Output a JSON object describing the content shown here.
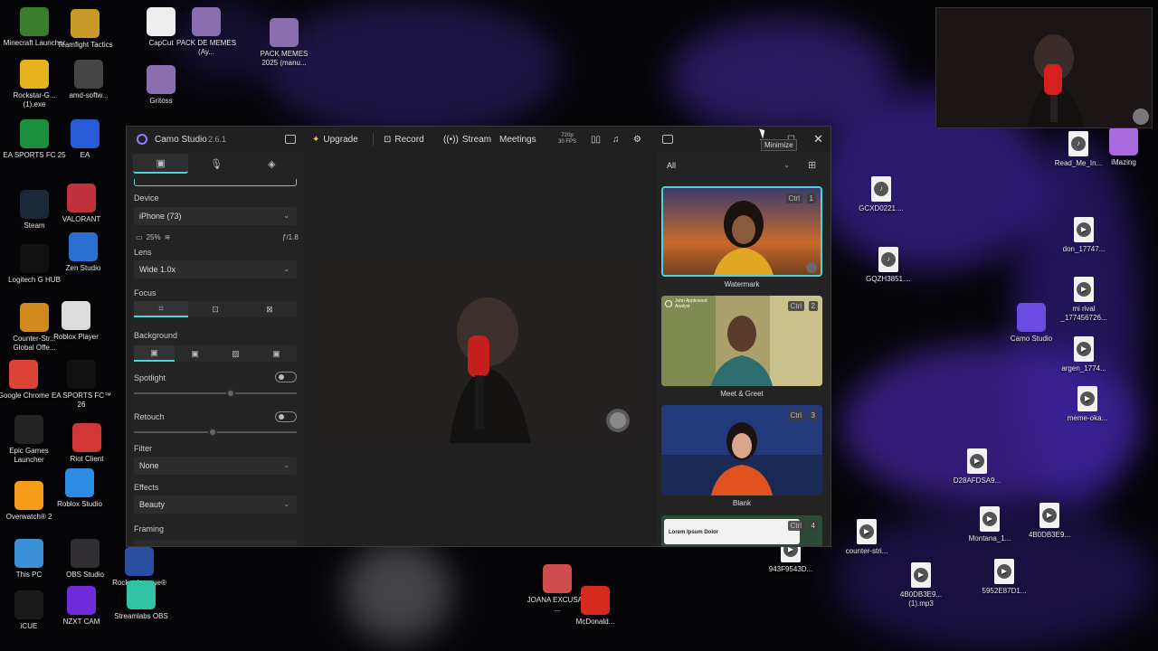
{
  "desktop_icons": [
    {
      "label": "Minecraft Launcher",
      "icon": "minecraft-icon",
      "color": "#3a7d2a"
    },
    {
      "label": "Teamfight Tactics",
      "icon": "tft-icon",
      "color": "#c79a2a"
    },
    {
      "label": "CapCut",
      "icon": "capcut-icon",
      "color": "#eeeeee"
    },
    {
      "label": "PACK DE MEMES (Ay...",
      "icon": "archive-icon",
      "color": "#8a6fb0"
    },
    {
      "label": "PACK MEMES 2025 (manu...",
      "icon": "archive-icon",
      "color": "#8a6fb0"
    },
    {
      "label": "Rockstar-G... (1).exe",
      "icon": "rockstar-icon",
      "color": "#e6b31e"
    },
    {
      "label": "amd-softw...",
      "icon": "amd-icon",
      "color": "#444444"
    },
    {
      "label": "Gritoss",
      "icon": "archive-icon",
      "color": "#8a6fb0"
    },
    {
      "label": "EA SPORTS FC 25",
      "icon": "fc25-icon",
      "color": "#1c8f3e"
    },
    {
      "label": "EA",
      "icon": "ea-icon",
      "color": "#2a5bd7"
    },
    {
      "label": "Steam",
      "icon": "steam-icon",
      "color": "#1b2838"
    },
    {
      "label": "VALORANT",
      "icon": "valorant-icon",
      "color": "#c0313f"
    },
    {
      "label": "Logitech G HUB",
      "icon": "ghub-icon",
      "color": "#111111"
    },
    {
      "label": "Zen Studio",
      "icon": "zen-icon",
      "color": "#2a6fd0"
    },
    {
      "label": "Counter-Str... Global Offe...",
      "icon": "csgo-icon",
      "color": "#d08a1e"
    },
    {
      "label": "Roblox Player",
      "icon": "roblox-icon",
      "color": "#dddddd"
    },
    {
      "label": "Google Chrome",
      "icon": "chrome-icon",
      "color": "#db4437"
    },
    {
      "label": "EA SPORTS FC™ 26",
      "icon": "fc26-icon",
      "color": "#111111"
    },
    {
      "label": "Epic Games Launcher",
      "icon": "epic-icon",
      "color": "#222222"
    },
    {
      "label": "Riot Client",
      "icon": "riot-icon",
      "color": "#d13639"
    },
    {
      "label": "Overwatch® 2",
      "icon": "overwatch-icon",
      "color": "#f99e1a"
    },
    {
      "label": "Roblox Studio",
      "icon": "roblox-studio-icon",
      "color": "#2d8ae3"
    },
    {
      "label": "This PC",
      "icon": "pc-icon",
      "color": "#3b8fd6"
    },
    {
      "label": "OBS Studio",
      "icon": "obs-icon",
      "color": "#302e31"
    },
    {
      "label": "Rocket League®",
      "icon": "rocket-league-icon",
      "color": "#2b4ea2"
    },
    {
      "label": "Streamlabs OBS",
      "icon": "streamlabs-icon",
      "color": "#31c3a2"
    },
    {
      "label": "iCUE",
      "icon": "icue-icon",
      "color": "#1a1a1a"
    },
    {
      "label": "NZXT CAM",
      "icon": "nzxt-icon",
      "color": "#6e2bd9"
    },
    {
      "label": "JOANA EXCUSAS ...",
      "icon": "archive-icon",
      "color": "#d04b4b"
    },
    {
      "label": "McDonald...",
      "icon": "mcdonalds-icon",
      "color": "#d52b1e"
    },
    {
      "label": "Read_Me_In...",
      "icon": "text-file-icon",
      "color": "#eeeeee"
    },
    {
      "label": "iMazing",
      "icon": "imazing-icon",
      "color": "#a86be0"
    },
    {
      "label": "GCXD0221....",
      "icon": "audio-file-icon",
      "color": "#eeeeee"
    },
    {
      "label": "don_17747...",
      "icon": "video-file-icon",
      "color": "#eeeeee"
    },
    {
      "label": "GQZH3851....",
      "icon": "audio-file-icon",
      "color": "#eeeeee"
    },
    {
      "label": "mi rival _177456726...",
      "icon": "video-file-icon",
      "color": "#eeeeee"
    },
    {
      "label": "Camo Studio",
      "icon": "camo-icon",
      "color": "#6a4de0"
    },
    {
      "label": "argen_1774...",
      "icon": "video-file-icon",
      "color": "#eeeeee"
    },
    {
      "label": "meme-oka...",
      "icon": "video-file-icon",
      "color": "#eeeeee"
    },
    {
      "label": "D28AFDSA9...",
      "icon": "video-file-icon",
      "color": "#eeeeee"
    },
    {
      "label": "Montana_1...",
      "icon": "video-file-icon",
      "color": "#eeeeee"
    },
    {
      "label": "4B0DB3E9...",
      "icon": "video-file-icon",
      "color": "#eeeeee"
    },
    {
      "label": "counter-stri...",
      "icon": "video-file-icon",
      "color": "#eeeeee"
    },
    {
      "label": "943F9543D...",
      "icon": "video-file-icon",
      "color": "#eeeeee"
    },
    {
      "label": "4B0DB3E9... (1).mp3",
      "icon": "video-file-icon",
      "color": "#eeeeee"
    },
    {
      "label": "5952E87D1...",
      "icon": "video-file-icon",
      "color": "#eeeeee"
    }
  ],
  "app": {
    "name": "Camo Studio",
    "version": "2.6.1",
    "upgrade": "Upgrade",
    "record": "Record",
    "stream": "Stream",
    "meetings": "Meetings",
    "res_top": "720p",
    "res_bottom": "30 FPS",
    "tooltip": "Minimize",
    "accent": "#4fd2d9"
  },
  "left_panel": {
    "device_label": "Device",
    "device_value": "iPhone (73)",
    "battery": "25%",
    "aperture": "ƒ/1.8",
    "lens_label": "Lens",
    "lens_value": "Wide 1.0x",
    "focus_label": "Focus",
    "background_label": "Background",
    "spotlight_label": "Spotlight",
    "retouch_label": "Retouch",
    "filter_label": "Filter",
    "filter_value": "None",
    "effects_label": "Effects",
    "effects_value": "Beauty",
    "framing_label": "Framing",
    "spotlight_level": 0.6,
    "retouch_level": 0.48
  },
  "right_panel": {
    "filter_value": "All",
    "overlays": [
      {
        "label": "Watermark",
        "ctrl": "Ctrl",
        "num": "1"
      },
      {
        "label": "Meet & Greet",
        "ctrl": "Ctrl",
        "num": "2",
        "caption_name": "John Appleseed",
        "caption_sub": "Analyst"
      },
      {
        "label": "Blank",
        "ctrl": "Ctrl",
        "num": "3"
      },
      {
        "label": "",
        "ctrl": "Ctrl",
        "num": "4",
        "caption": "Lorem Ipsum Dolor"
      }
    ]
  }
}
